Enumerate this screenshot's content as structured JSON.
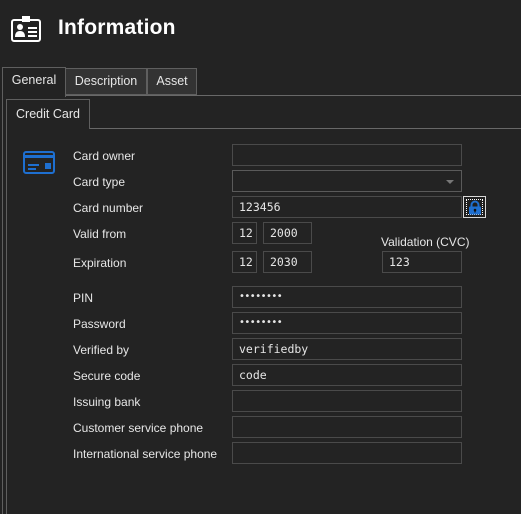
{
  "header": {
    "title": "Information",
    "icon": "id-card-icon"
  },
  "tabs": [
    {
      "label": "General",
      "active": true
    },
    {
      "label": "Description",
      "active": false
    },
    {
      "label": "Asset",
      "active": false
    }
  ],
  "subtabs": [
    {
      "label": "Credit Card",
      "active": true
    }
  ],
  "colors": {
    "accent": "#1e6fd0",
    "background": "#232323",
    "border": "#4a4a4a"
  },
  "form": {
    "section_icon": "credit-card-icon",
    "card_owner": {
      "label": "Card owner",
      "value": ""
    },
    "card_type": {
      "label": "Card type",
      "value": ""
    },
    "card_number": {
      "label": "Card number",
      "value": "123456",
      "lock_icon": "lock-icon"
    },
    "valid_from": {
      "label": "Valid from",
      "month": "12",
      "year": "2000"
    },
    "expiration": {
      "label": "Expiration",
      "month": "12",
      "year": "2030"
    },
    "cvc": {
      "label": "Validation (CVC)",
      "value": "123"
    },
    "pin": {
      "label": "PIN",
      "value": "••••••••"
    },
    "password": {
      "label": "Password",
      "value": "••••••••"
    },
    "verified_by": {
      "label": "Verified by",
      "value": "verifiedby"
    },
    "secure_code": {
      "label": "Secure code",
      "value": "code"
    },
    "issuing_bank": {
      "label": "Issuing bank",
      "value": ""
    },
    "customer_service_phone": {
      "label": "Customer service phone",
      "value": ""
    },
    "international_service_phone": {
      "label": "International service phone",
      "value": ""
    }
  }
}
